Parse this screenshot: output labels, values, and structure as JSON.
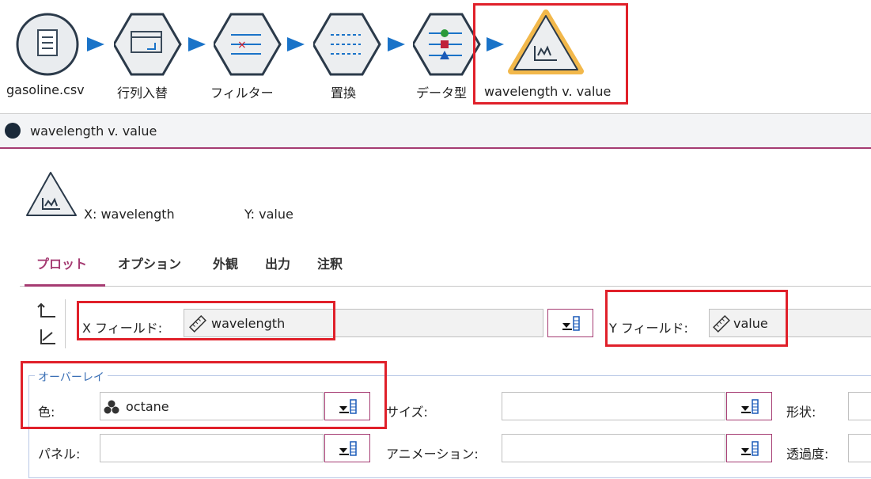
{
  "stream": {
    "nodes": [
      {
        "label": "gasoline.csv"
      },
      {
        "label": "行列入替"
      },
      {
        "label": "フィルター"
      },
      {
        "label": "置換"
      },
      {
        "label": "データ型"
      },
      {
        "label": "wavelength v. value"
      }
    ]
  },
  "window": {
    "title": "wavelength v. value"
  },
  "header": {
    "x_text": "X: wavelength",
    "y_text": "Y: value"
  },
  "tabs": [
    "プロット",
    "オプション",
    "外観",
    "出力",
    "注釈"
  ],
  "fields": {
    "x_label": "X フィールド:",
    "x_value": "wavelength",
    "y_label": "Y フィールド:",
    "y_value": "value"
  },
  "overlay": {
    "title": "オーバーレイ",
    "color_label": "色:",
    "color_value": "octane",
    "size_label": "サイズ:",
    "shape_label": "形状:",
    "panel_label": "パネル:",
    "animation_label": "アニメーション:",
    "transparency_label": "透過度:"
  },
  "colors": {
    "accent": "#a53b72",
    "highlight": "#e0202a",
    "arrow": "#1a73c8",
    "selected_node": "#f2b84b"
  }
}
